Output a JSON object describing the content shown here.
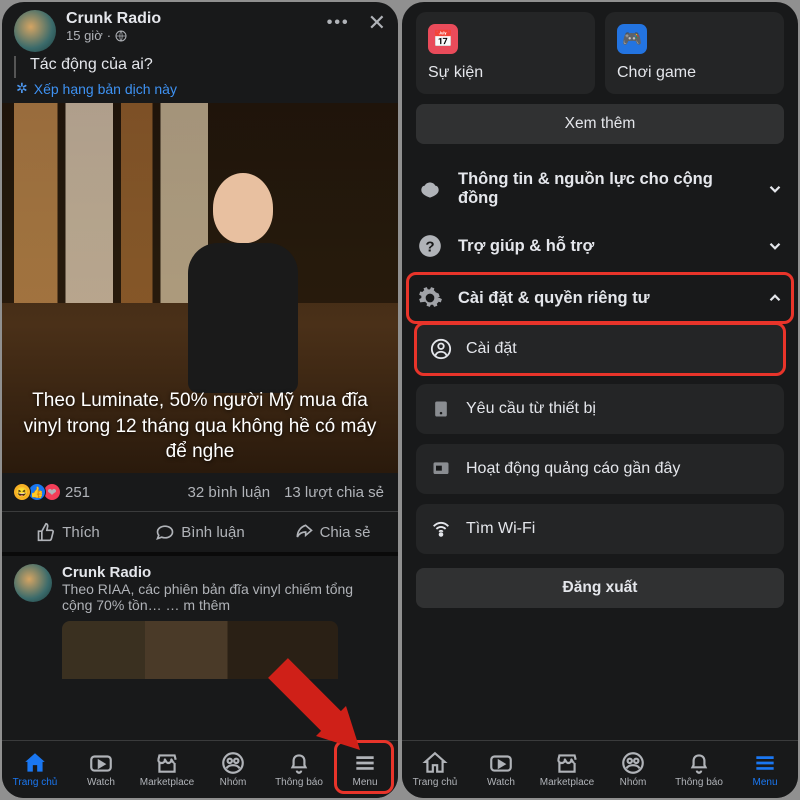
{
  "left": {
    "post": {
      "author": "Crunk Radio",
      "time": "15 giờ",
      "text": "Tác động của ai?",
      "translate": "Xếp hạng bản dịch này",
      "overlay": "Theo Luminate, 50% người Mỹ mua đĩa vinyl trong 12 tháng qua không hề có máy để nghe",
      "likes": "251",
      "comments": "32 bình luận",
      "shares": "13 lượt chia sẻ",
      "like_label": "Thích",
      "comment_label": "Bình luận",
      "share_label": "Chia sẻ"
    },
    "next_post": {
      "author": "Crunk Radio",
      "text": "Theo RIAA, các phiên bản đĩa vinyl chiếm tổng cộng 70% tồn…",
      "more": "… m thêm"
    },
    "nav": [
      "Trang chủ",
      "Watch",
      "Marketplace",
      "Nhóm",
      "Thông báo",
      "Menu"
    ]
  },
  "right": {
    "tiles": [
      {
        "icon": "📅",
        "label": "Sự kiện"
      },
      {
        "icon": "🎮",
        "label": "Chơi game"
      }
    ],
    "see_more": "Xem thêm",
    "sections": [
      {
        "icon": "hands",
        "label": "Thông tin & nguồn lực cho cộng đồng",
        "expanded": false
      },
      {
        "icon": "help",
        "label": "Trợ giúp & hỗ trợ",
        "expanded": false
      },
      {
        "icon": "gear",
        "label": "Cài đặt & quyền riêng tư",
        "expanded": true
      }
    ],
    "sub_items": [
      {
        "icon": "user",
        "label": "Cài đặt"
      },
      {
        "icon": "device",
        "label": "Yêu cầu từ thiết bị"
      },
      {
        "icon": "ads",
        "label": "Hoạt động quảng cáo gần đây"
      },
      {
        "icon": "wifi",
        "label": "Tìm Wi-Fi"
      }
    ],
    "logout": "Đăng xuất",
    "nav": [
      "Trang chủ",
      "Watch",
      "Marketplace",
      "Nhóm",
      "Thông báo",
      "Menu"
    ]
  }
}
